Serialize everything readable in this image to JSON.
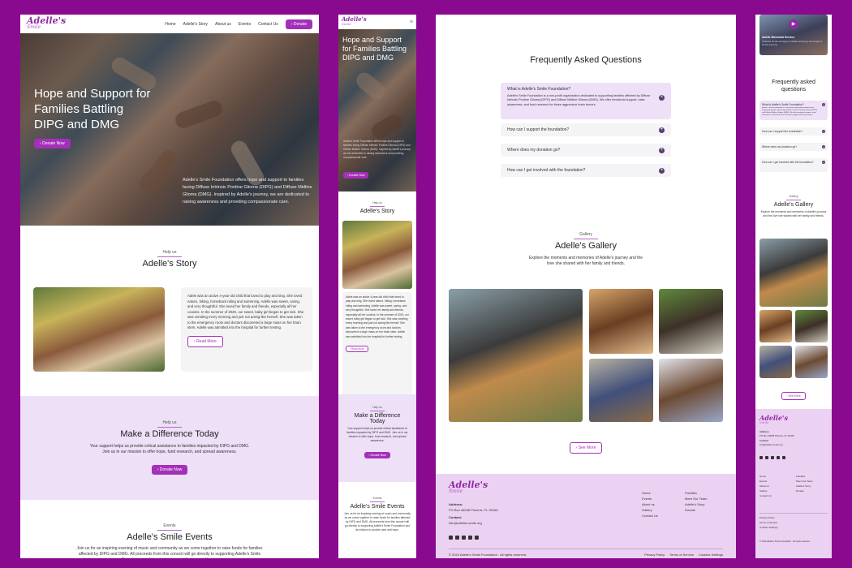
{
  "brand": {
    "logo_main": "Adelle's",
    "logo_sub": "Smile",
    "accent": "#a430b9",
    "backdrop": "#8a0a8f"
  },
  "nav": {
    "items": [
      "Home",
      "Adelle's Story",
      "About us",
      "Events",
      "Contact Us"
    ],
    "donate": "Donate"
  },
  "hero": {
    "title": "Hope and Support for Families Battling DIPG and DMG",
    "title_mobile": "Hope and Support for Families Battling DIPG and DMG",
    "cta": "Donate Now",
    "description": "Adelle's Smile Foundation offers hope and support to families facing Diffuse Intrinsic Pontine Glioma (DIPG) and Diffuse Midline Glioma (DMG). Inspired by Adelle's journey, we are dedicated to raising awareness and providing compassionate care."
  },
  "story": {
    "tag": "Help us",
    "title": "Adelle's Story",
    "body": "Adele was an active 4-year-old child that loved to play and sing. She loved nature, hiking, horseback riding and swimming. Adelle was sweet, caring, and very thoughtful. She loved her family and friends, especially all her cousins. In the summer of 2020, our sweet, baby girl began to get sick. She was vomiting every morning and just not acting like herself. She was taken to the emergency room and doctors discovered a large mass on her brain stem. Adelle was admitted into the hospital for further testing.",
    "read_more": "Read More"
  },
  "difference": {
    "tag": "Help us",
    "title": "Make a Difference Today",
    "body": "Your support helps us provide critical assistance to families impacted by DIPG and DMG. Join us in our mission to offer hope, fund research, and spread awareness.",
    "cta": "Donate Now"
  },
  "events": {
    "tag": "Events",
    "title": "Adelle's Smile Events",
    "body": "Join us for an inspiring evening of music and community as we come together to raise funds for families affected by DIPG and DMG. All proceeds from this concert will go directly to supporting Adelle's Smile Foundation and its mission to provide care and hope."
  },
  "faq": {
    "title": "Frequently Asked Questions",
    "title_mobile": "Frequently asked questions",
    "items": [
      {
        "q": "What is Adelle's Smile Foundation?",
        "a": "Adelle's Smile Foundation is a non-profit organization dedicated to supporting families affected by Diffuse Intrinsic Pontine Glioma (DIPG) and Diffuse Midline Glioma (DMG). We offer emotional support, raise awareness, and fund research for these aggressive brain tumors."
      },
      {
        "q": "How can I support the foundation?",
        "a": ""
      },
      {
        "q": "Where does my donation go?",
        "a": ""
      },
      {
        "q": "How can I get involved with the foundation?",
        "a": ""
      }
    ]
  },
  "gallery": {
    "tag": "Gallery",
    "title": "Adelle's Gallery",
    "body": "Explore the moments and memories of Adelle's journey and the love she shared with her family and friends.",
    "see_more": "See More"
  },
  "footer": {
    "address_label": "Address:",
    "address": "PO Box 46038 Phoenix, FL 33168",
    "contact_label": "Contact:",
    "contact": "info@adelles-smile.org",
    "col1": [
      "Home",
      "Events",
      "About us",
      "Gallery",
      "Contact Us"
    ],
    "col2": [
      "Families",
      "Meet Our Team",
      "Adelle's Story",
      "Donate"
    ],
    "copyright": "© 2024 Adelle's Smile Foundation . All rights reserved.",
    "legal": [
      "Privacy Policy",
      "Terms of Service",
      "Cookies Settings"
    ]
  },
  "video": {
    "title": "Adelle Memorial Service",
    "caption": "Celebrate the life and legacy of Adelle and the joy she brought to all who knew her."
  }
}
